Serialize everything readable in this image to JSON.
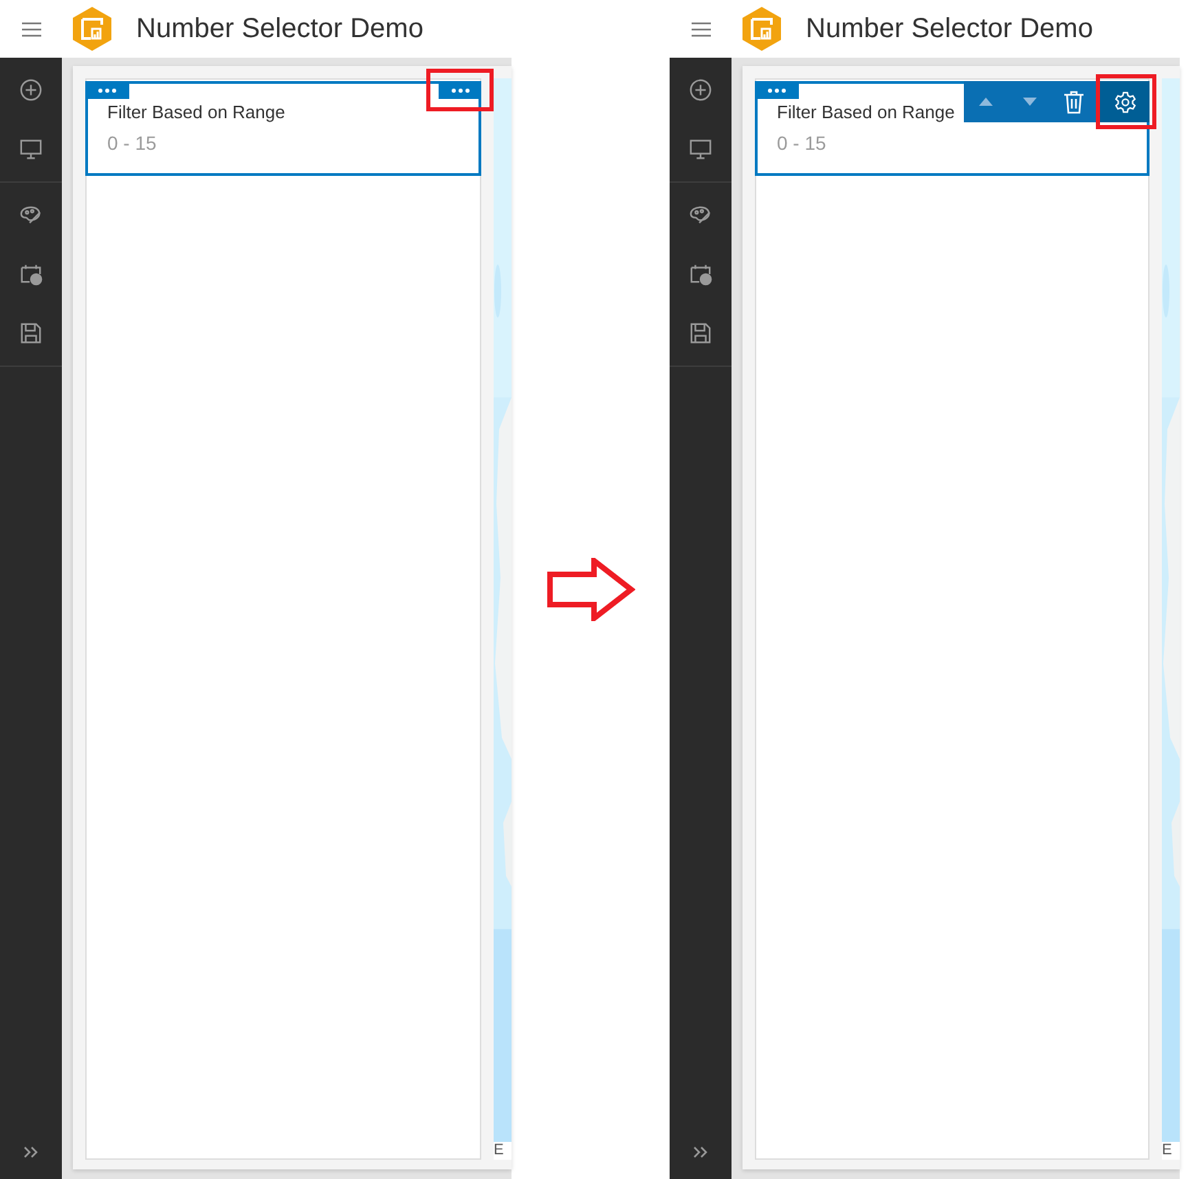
{
  "panels": [
    {
      "app_title": "Number Selector Demo",
      "widget": {
        "title": "Filter Based on Range",
        "range": "0 - 15",
        "actions": [
          {
            "kind": "more",
            "highlighted": true
          }
        ]
      },
      "attribution": "E"
    },
    {
      "app_title": "Number Selector Demo",
      "widget": {
        "title": "Filter Based on Range",
        "range": "0 - 15",
        "actions": [
          {
            "kind": "move_up",
            "highlighted": false
          },
          {
            "kind": "move_down",
            "highlighted": false
          },
          {
            "kind": "delete",
            "highlighted": false
          },
          {
            "kind": "settings",
            "highlighted": true
          }
        ]
      },
      "attribution": "E"
    }
  ]
}
